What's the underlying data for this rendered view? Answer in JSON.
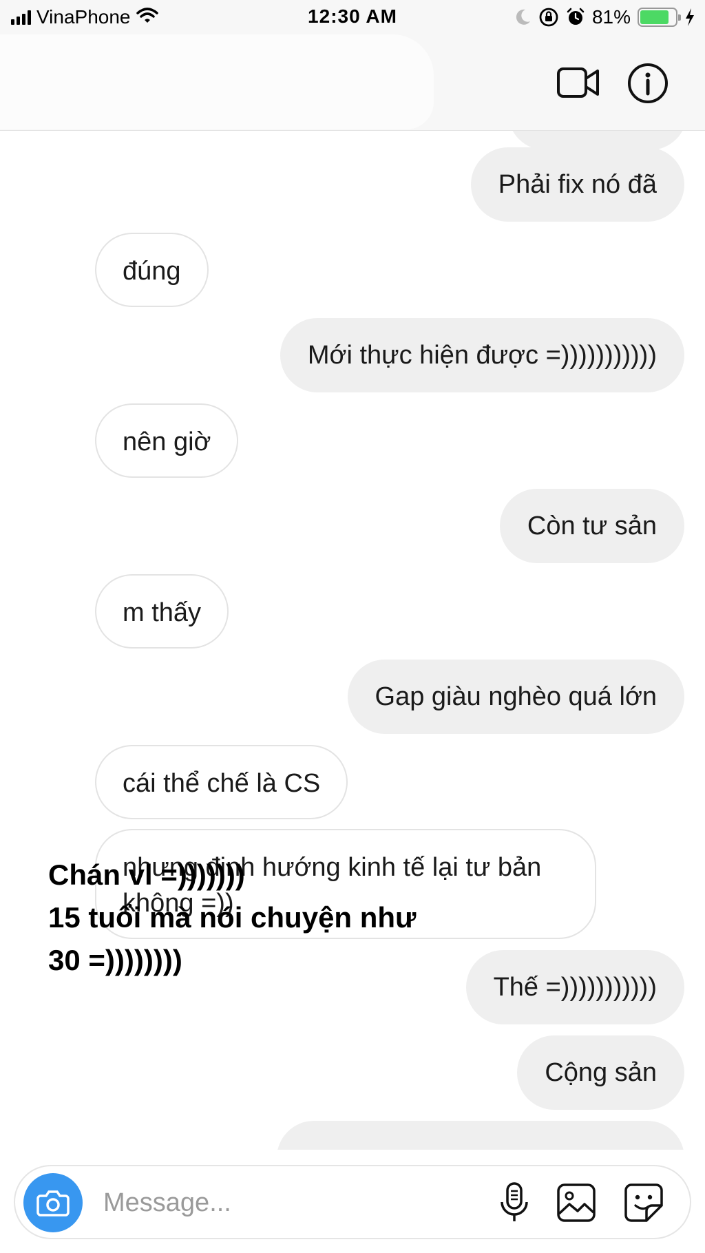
{
  "status_bar": {
    "carrier": "VinaPhone",
    "time": "12:30 AM",
    "battery_percent": "81%",
    "battery_level": 0.81,
    "icons": [
      "signal-icon",
      "wifi-icon",
      "moon-icon",
      "orientation-lock-icon",
      "alarm-icon",
      "battery-icon",
      "charging-icon"
    ]
  },
  "header": {
    "icons": [
      "video-call-icon",
      "info-icon"
    ]
  },
  "messages": [
    {
      "direction": "outgoing",
      "text": "Phải fix nó đã"
    },
    {
      "direction": "incoming",
      "text": "đúng"
    },
    {
      "direction": "outgoing",
      "text": "Mới thực hiện được =)))))))))))"
    },
    {
      "direction": "incoming",
      "text": "nên giờ"
    },
    {
      "direction": "outgoing",
      "text": "Còn tư sản"
    },
    {
      "direction": "incoming",
      "text": "m thấy"
    },
    {
      "direction": "outgoing",
      "text": "Gap giàu nghèo quá lớn"
    },
    {
      "direction": "incoming",
      "text": "cái thể chế là CS"
    },
    {
      "direction": "incoming",
      "text": "nhưng định hướng kinh tế lại tư bản không =))"
    },
    {
      "direction": "outgoing",
      "text": "Thế =)))))))))))"
    },
    {
      "direction": "outgoing",
      "text": "Cộng sản"
    }
  ],
  "overlay_caption": {
    "line1": "Chán vl =)))))))",
    "line2": "15 tuổi mà nói chuyện như",
    "line3": "30 =))))))))"
  },
  "composer": {
    "placeholder": "Message...",
    "value": "",
    "icons": [
      "camera-icon",
      "microphone-icon",
      "gallery-icon",
      "sticker-icon"
    ]
  },
  "colors": {
    "accent": "#3897f0",
    "outgoing_bubble": "#efefef",
    "incoming_border": "#e3e3e3",
    "battery": "#4cd964"
  }
}
